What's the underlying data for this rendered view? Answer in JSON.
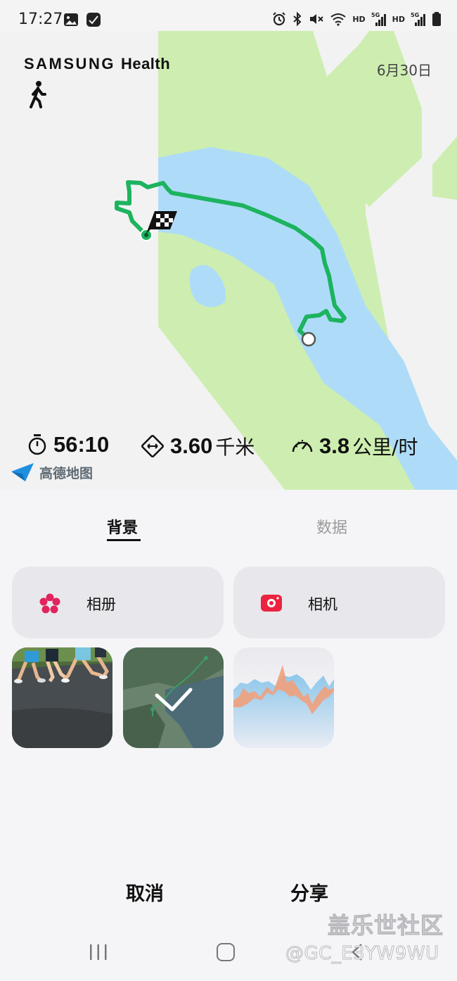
{
  "status_bar": {
    "time": "17:27",
    "hd1": "HD",
    "hd2": "HD",
    "signal1": "5G",
    "signal2": "5G",
    "icons_left": [
      "gallery-icon",
      "check-app-icon"
    ],
    "icons_right": [
      "alarm-icon",
      "bluetooth-icon",
      "mute-icon",
      "wifi-icon",
      "signal-icon",
      "battery-icon"
    ]
  },
  "map": {
    "brand_samsung": "SAMSUNG",
    "brand_health": "Health",
    "date": "6月30日",
    "activity_icon": "walking-icon",
    "route_color": "#1db35f",
    "water_color": "#aedcf8",
    "park_color": "#cdeeb0",
    "provider": "高德地图",
    "stats": {
      "duration": "56:10",
      "distance": "3.60",
      "distance_unit": "千米",
      "speed": "3.8",
      "speed_unit": "公里/时"
    }
  },
  "tabs": [
    {
      "label": "背景",
      "selected": true
    },
    {
      "label": "数据",
      "selected": false
    }
  ],
  "sources": {
    "album": "相册",
    "camera": "相机"
  },
  "backgrounds": [
    "runners-photo",
    "route-map",
    "data-chart"
  ],
  "selected_background": "route-map",
  "footer": {
    "cancel": "取消",
    "share": "分享"
  },
  "watermark": {
    "line1": "盖乐世社区",
    "line2": "@GC_E3YW9WU"
  }
}
